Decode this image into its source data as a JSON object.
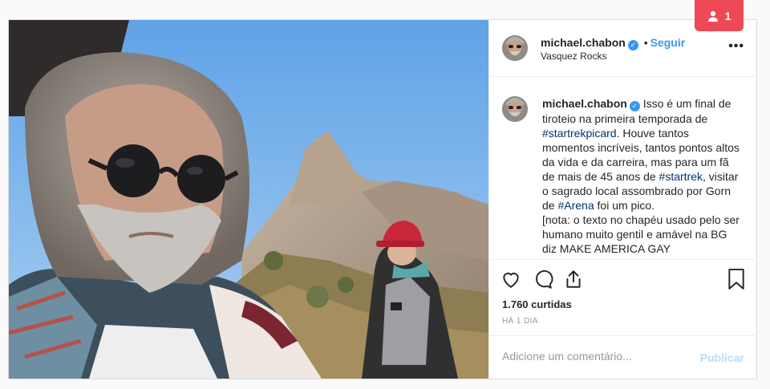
{
  "post": {
    "username": "michael.chabon",
    "follow_label": "Seguir",
    "separator": "•",
    "location": "Vasquez Rocks",
    "caption_parts": [
      "Isso é um final de tiroteio na primeira temporada de ",
      "#startrekpicard",
      ". Houve tantos momentos incríveis, tantos pontos altos da vida e da carreira, mas para um fã de mais de 45 anos de ",
      "#startrek",
      ", visitar o sagrado local assombrado por Gorn de ",
      "#Arena",
      " foi um pico.",
      "[nota: o texto no chapéu usado pelo ser humano muito gentil e amável na BG diz MAKE AMERICA GAY"
    ],
    "likes": "1.760 curtidas",
    "time": "HÁ 1 DIA",
    "comment_placeholder": "Adicione um comentário...",
    "publish_label": "Publicar",
    "more_label": "•••",
    "verified_mark": "✓"
  },
  "notification": {
    "count": "1"
  },
  "colors": {
    "link": "#3897f0",
    "hashtag": "#003569",
    "notification": "#ed4956",
    "publish_disabled": "#b2dffc"
  }
}
